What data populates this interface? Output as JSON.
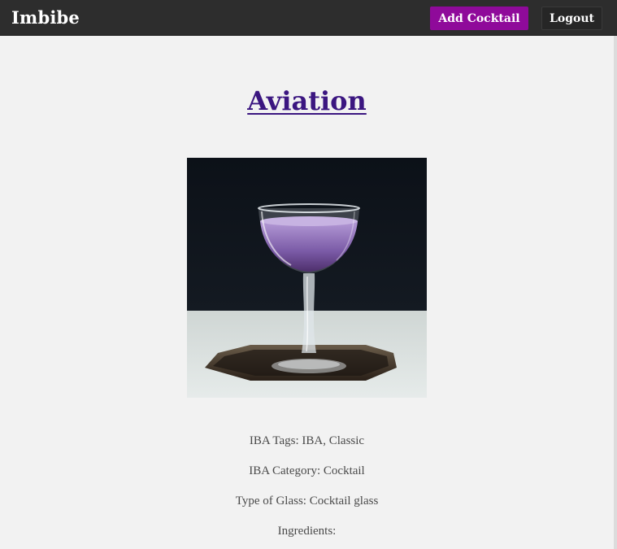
{
  "navbar": {
    "brand": "Imbibe",
    "add_button": "Add Cocktail",
    "logout_button": "Logout"
  },
  "cocktail": {
    "name": "Aviation",
    "image_icon": "cocktail-photo",
    "details": {
      "iba_tags": "IBA Tags: IBA, Classic",
      "iba_category": "IBA Category: Cocktail",
      "glass": "Type of Glass: Cocktail glass",
      "ingredients_label": "Ingredients:"
    }
  },
  "colors": {
    "navbar_bg": "#2d2d2d",
    "accent": "#8f0a9a",
    "title_link": "#3b1680",
    "page_bg": "#f2f2f2"
  }
}
